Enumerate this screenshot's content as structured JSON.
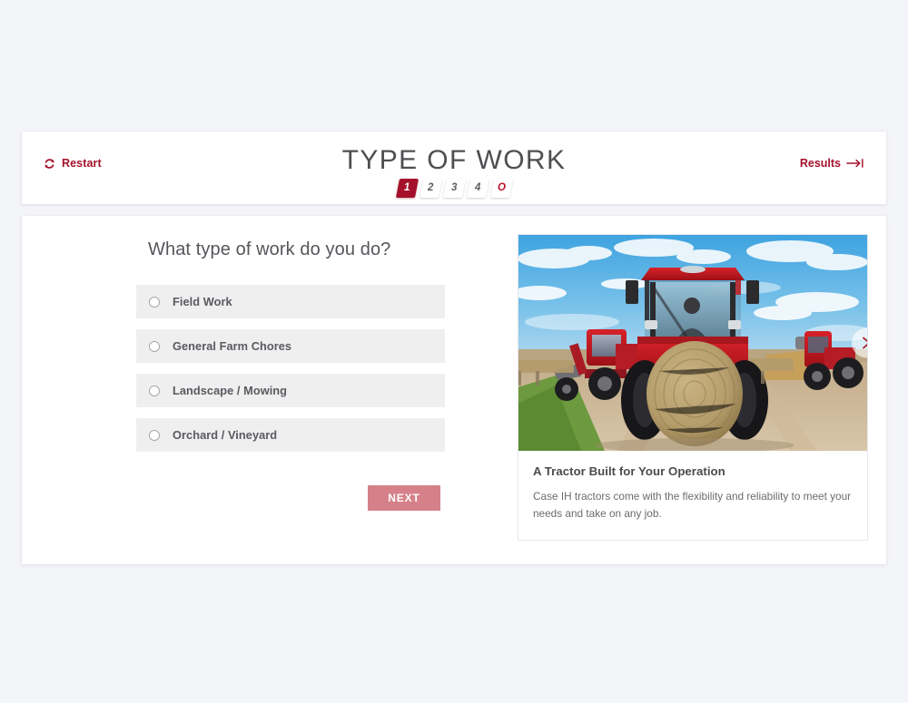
{
  "theme": {
    "page_bg": "#f4f5f9",
    "brand_red": "#a5112b",
    "accent_red": "#bb0b26",
    "next_button_bg": "#d68089",
    "option_bg": "#efeff0"
  },
  "header": {
    "title": "TYPE OF WORK",
    "restart": {
      "label": "Restart",
      "icon": "refresh-icon"
    },
    "results": {
      "label": "Results",
      "icon": "arrow-to-end-icon"
    },
    "steps": [
      {
        "label": "1",
        "state": "active"
      },
      {
        "label": "2",
        "state": "inactive"
      },
      {
        "label": "3",
        "state": "inactive"
      },
      {
        "label": "4",
        "state": "inactive"
      },
      {
        "label": "O",
        "state": "flag"
      }
    ]
  },
  "quiz": {
    "question": "What type of work do you do?",
    "options": [
      {
        "label": "Field Work",
        "selected": false
      },
      {
        "label": "General Farm Chores",
        "selected": false
      },
      {
        "label": "Landscape / Mowing",
        "selected": false
      },
      {
        "label": "Orchard / Vineyard",
        "selected": false
      }
    ],
    "next_label": "NEXT"
  },
  "promo": {
    "image_alt": "Red Case IH tractors on a dirt farm road, one carrying a large round hay bale, under a blue sky with clouds",
    "carousel_next_icon": "chevron-right-icon",
    "title": "A Tractor Built for Your Operation",
    "text": "Case IH tractors come with the flexibility and reliability to meet your needs and take on any job."
  }
}
